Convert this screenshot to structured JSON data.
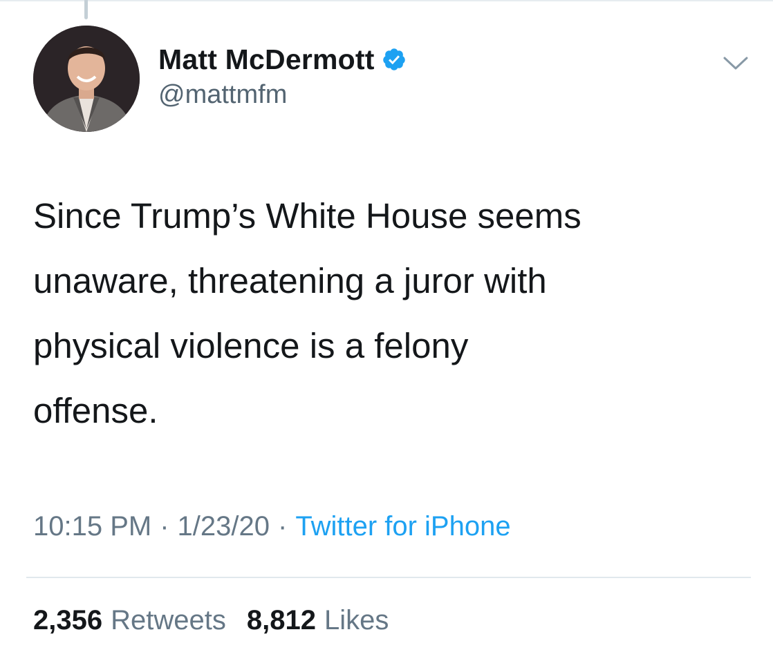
{
  "tweet": {
    "author": {
      "display_name": "Matt McDermott",
      "handle": "@mattmfm",
      "verified": true
    },
    "text": "Since Trump’s White House seems\nunaware, threatening a juror with\nphysical violence is a felony\noffense.",
    "time": "10:15 PM",
    "separator": "·",
    "date": "1/23/20",
    "source": "Twitter for iPhone",
    "stats": {
      "retweets_count": "2,356",
      "retweets_label": "Retweets",
      "likes_count": "8,812",
      "likes_label": "Likes"
    }
  },
  "icons": {
    "verified": "verified-badge-icon",
    "menu": "chevron-down-icon"
  },
  "colors": {
    "verified_blue": "#1da1f2",
    "link_blue": "#1da1f2",
    "text_primary": "#14171a",
    "text_secondary": "#657786",
    "divider": "#e1e8ed"
  }
}
